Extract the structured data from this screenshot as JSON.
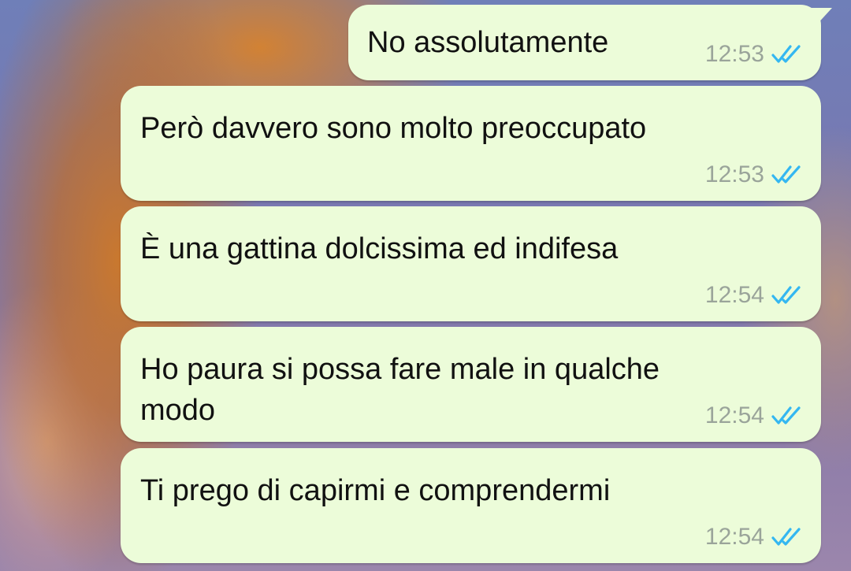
{
  "messages": [
    {
      "text": "No assolutamente",
      "time": "12:53",
      "status_icon": "double-check-read-icon"
    },
    {
      "text": "Però davvero sono molto preoccupato",
      "time": "12:53",
      "status_icon": "double-check-read-icon"
    },
    {
      "text": "È una gattina dolcissima ed indifesa",
      "time": "12:54",
      "status_icon": "double-check-read-icon"
    },
    {
      "text": "Ho paura si possa fare male in qualche modo",
      "time": "12:54",
      "status_icon": "double-check-read-icon"
    },
    {
      "text": "Ti prego di capirmi e comprendermi",
      "time": "12:54",
      "status_icon": "double-check-read-icon"
    }
  ],
  "colors": {
    "bubble": "#ecfcd9",
    "time_text": "#9aa49a",
    "read_ticks": "#34b7f1"
  }
}
